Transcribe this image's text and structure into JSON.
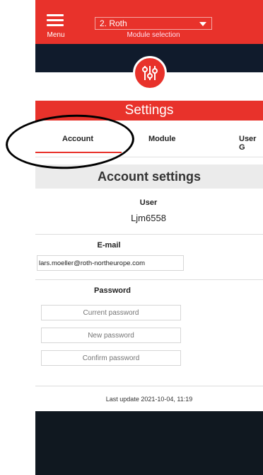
{
  "header": {
    "menu_label": "Menu",
    "module_selected": "2. Roth",
    "module_caption": "Module selection"
  },
  "page": {
    "title": "Settings"
  },
  "tabs": [
    {
      "label": "Account",
      "active": true
    },
    {
      "label": "Module"
    },
    {
      "label": "User G"
    }
  ],
  "account": {
    "section_title": "Account settings",
    "user_label": "User",
    "user_value": "Ljm6558",
    "email_label": "E-mail",
    "email_value": "lars.moeller@roth-northeurope.com",
    "password_label": "Password",
    "current_password_placeholder": "Current password",
    "new_password_placeholder": "New password",
    "confirm_password_placeholder": "Confirm password",
    "last_update": "Last update 2021-10-04, 11:19"
  },
  "colors": {
    "brand_red": "#e8322b",
    "navy": "#101b2c"
  },
  "icons": {
    "menu": "hamburger-icon",
    "dropdown": "chevron-down-icon",
    "logo": "sliders-icon"
  }
}
